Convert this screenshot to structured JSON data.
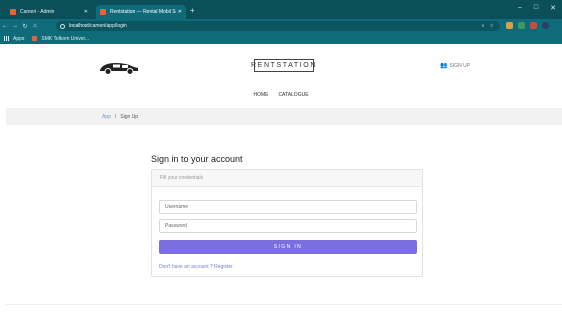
{
  "browser": {
    "tabs": [
      {
        "title": "Cameri - Admin",
        "active": false
      },
      {
        "title": "Rentstation — Rental Mobil Serv",
        "active": true
      }
    ],
    "url_host": "localhost",
    "url_path": "/cameri/app/login",
    "bookmarks": [
      "Apps",
      "SMK Telkom Univer..."
    ]
  },
  "site": {
    "brand": "RENTSTATION",
    "signup": "SIGN UP",
    "nav": [
      "HOME",
      "CATALOGUE"
    ],
    "breadcrumb": {
      "home": "App",
      "separator": "/",
      "current": "Sign Up"
    }
  },
  "signin": {
    "heading": "Sign in to your account",
    "subheading": "Fill your credentials",
    "username_placeholder": "Username",
    "password_placeholder": "Password",
    "submit": "SIGN IN",
    "register": "Don't have an account ? Register"
  },
  "colors": {
    "browser_frame": "#0f6b79",
    "accent": "#7b6fe0",
    "link": "#6d7fd0"
  }
}
